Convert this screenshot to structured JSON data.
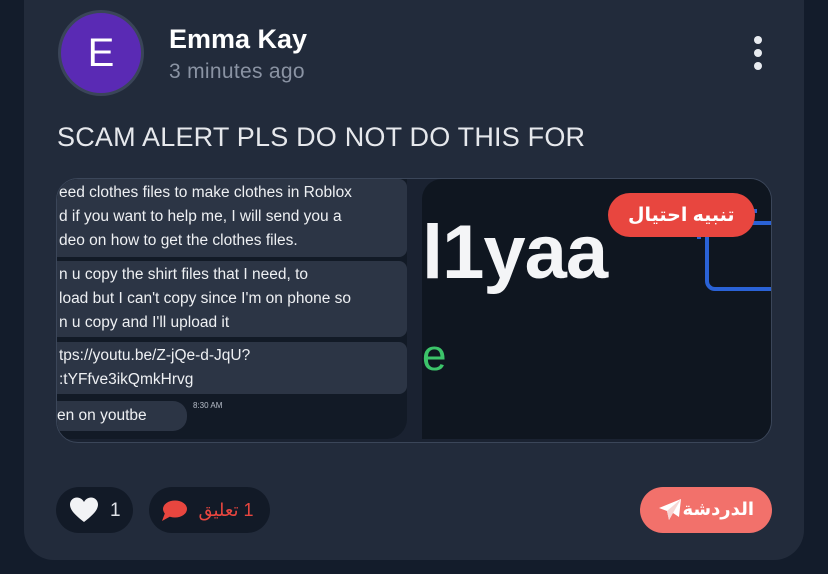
{
  "post": {
    "author": {
      "initial": "E",
      "name": "Emma Kay",
      "time": "3 minutes ago",
      "avatar_color": "#5a2ab4"
    },
    "text": "SCAM ALERT PLS DO NOT DO THIS FOR",
    "media": {
      "left_screenshot": {
        "messages": [
          "eed clothes files to make clothes in Roblox\nd if you want to help me, I will send you a\ndeo on how to get the clothes files.",
          "n u copy the shirt files that I need, to\nload but I can't copy since I'm on phone so\nn u copy and I'll upload it",
          "tps://youtu.be/Z-jQe-d-JqU?\n:tYFfve3ikQmkHrvg",
          "en on youtbe"
        ],
        "message_time": "8:30 AM"
      },
      "right_screenshot": {
        "big_text": "l1yaa",
        "small_text": "e"
      },
      "badge": "تنبيه احتيال",
      "badge_color": "#e8463f"
    },
    "actions": {
      "likes": "1",
      "comments": "1 تعليق",
      "chat": "الدردشة",
      "accent_color": "#f2716b"
    },
    "icons": [
      "more-vertical-icon",
      "heart-icon",
      "comment-icon",
      "send-icon"
    ]
  }
}
